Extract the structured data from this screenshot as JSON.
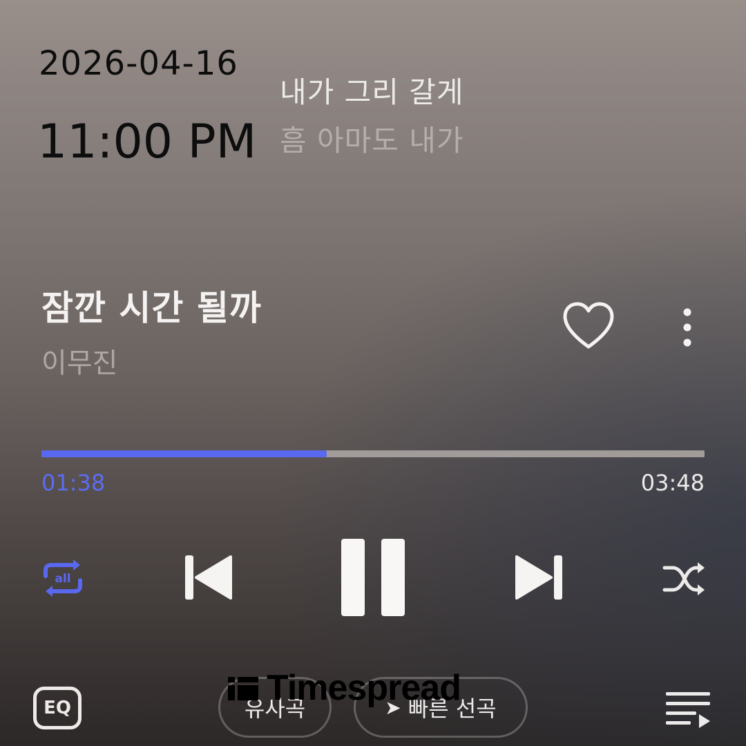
{
  "clock": {
    "date": "2026-04-16",
    "time": "11:00 PM"
  },
  "lyrics": {
    "current": "내가 그리 갈게",
    "next": "흠 아마도 내가"
  },
  "track": {
    "title": "잠깐 시간 될까",
    "artist": "이무진",
    "liked": false
  },
  "progress": {
    "elapsed": "01:38",
    "total": "03:48",
    "fraction": 0.43
  },
  "controls": {
    "repeat_icon": "repeat-all-icon",
    "repeat_label": "all",
    "prev_icon": "skip-previous-icon",
    "play_state": "playing",
    "pause_icon": "pause-icon",
    "next_icon": "skip-next-icon",
    "shuffle_icon": "shuffle-icon"
  },
  "bottom": {
    "eq_label": "EQ",
    "similar_label": "유사곡",
    "fast_new_label": "빠른 선곡",
    "playlist_icon": "playlist-icon"
  },
  "watermark": {
    "text": "Timespread"
  },
  "colors": {
    "accent": "#5a68f0",
    "track": "#a19b99",
    "text": "#f4f3f2",
    "clock": "#0d0d0d"
  }
}
